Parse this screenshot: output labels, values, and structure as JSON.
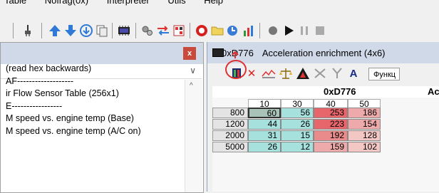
{
  "menubar": {
    "items": [
      "Table",
      "Nofrag(0x)",
      "Interpreter",
      "Utils",
      "Help"
    ]
  },
  "toolbar": {
    "icons": [
      "usb-plug-icon",
      "arrow-up-icon",
      "arrow-down-icon",
      "download-circle-icon",
      "copy-page-icon",
      "chip-icon",
      "gears-icon",
      "swap-arrows-icon",
      "flag-chart-icon",
      "stop-circle-icon",
      "folder-icon",
      "clock-chart-icon",
      "bar-chart-icon",
      "record-icon",
      "play-icon",
      "pause-icon",
      "stop-square-icon"
    ]
  },
  "left_panel": {
    "close_label": "x",
    "list_items": [
      "(read hex backwards)",
      "AF-------------------",
      "ir Flow Sensor Table (256x1)",
      "E-----------------",
      "M speed vs. engine temp (Base)",
      "M speed vs. engine temp (A/C on)"
    ]
  },
  "right_panel": {
    "address": "0xD776",
    "title": "Acceleration enrichment (4x6)",
    "function_tab": "Функц",
    "table_title_addr": "0xD776",
    "table_title_rest": "Ac"
  },
  "table": {
    "col_headers": [
      "10",
      "30",
      "40",
      "50"
    ],
    "rows": [
      {
        "rpm": "800",
        "values": [
          "60",
          "56",
          "253",
          "186"
        ]
      },
      {
        "rpm": "1200",
        "values": [
          "44",
          "26",
          "223",
          "154"
        ]
      },
      {
        "rpm": "2000",
        "values": [
          "31",
          "15",
          "192",
          "128"
        ]
      },
      {
        "rpm": "5000",
        "values": [
          "26",
          "12",
          "159",
          "102"
        ]
      }
    ],
    "colors": {
      "selected": "#a9c3b9",
      "teal": "#a6e1de",
      "red_high": "#e6666c",
      "red_mid": "#e98a8b",
      "red_low": "#eeaaaa",
      "pink": "#f3c7c4"
    }
  }
}
